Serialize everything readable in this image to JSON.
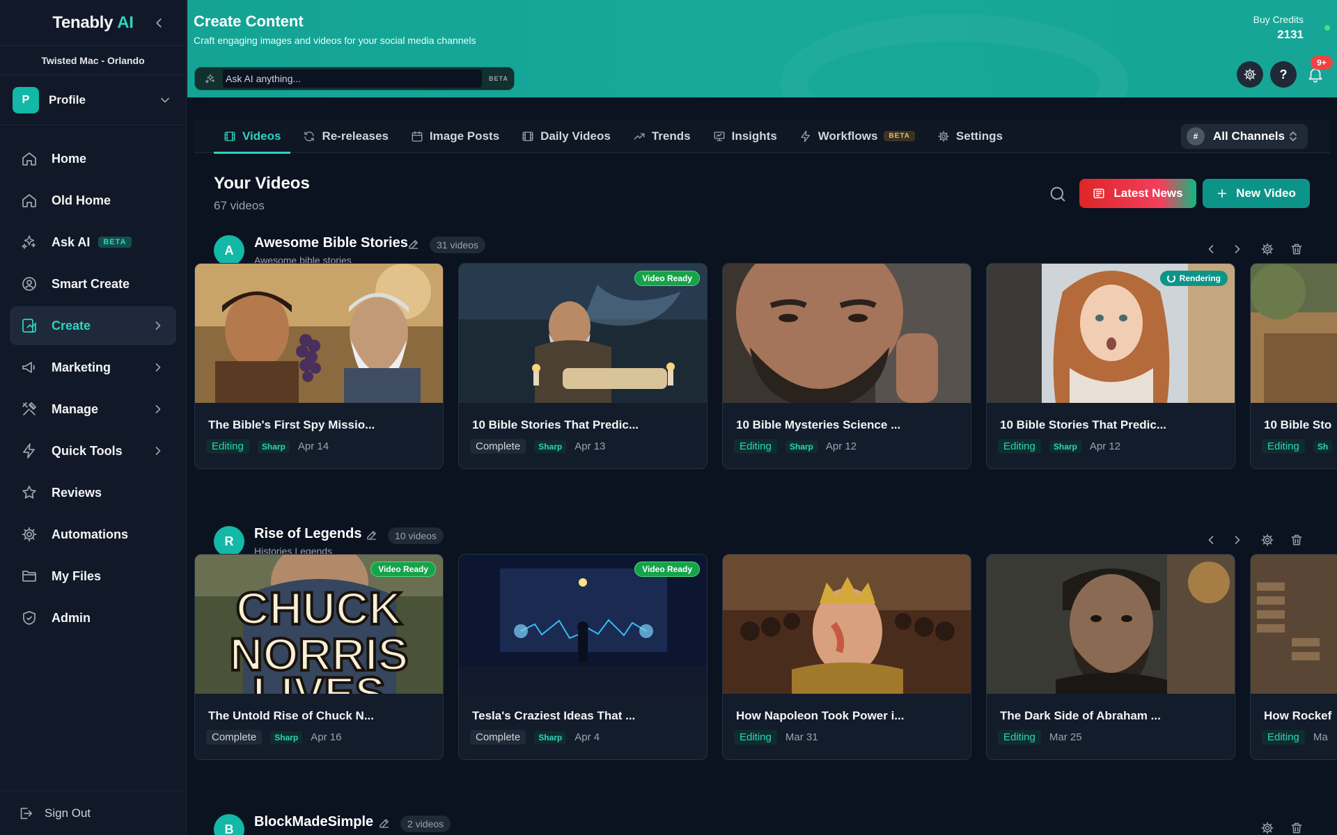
{
  "app": {
    "logo_main": "Tenably",
    "logo_accent": "AI",
    "org": "Twisted Mac - Orlando"
  },
  "profile": {
    "initial": "P",
    "label": "Profile"
  },
  "sidebar": {
    "items": [
      {
        "label": "Home",
        "icon": "home-icon"
      },
      {
        "label": "Old Home",
        "icon": "home-icon"
      },
      {
        "label": "Ask AI",
        "icon": "sparkle-icon",
        "badge": "BETA"
      },
      {
        "label": "Smart Create",
        "icon": "user-circle-icon"
      },
      {
        "label": "Create",
        "icon": "create-icon",
        "active": true
      },
      {
        "label": "Marketing",
        "icon": "megaphone-icon"
      },
      {
        "label": "Manage",
        "icon": "tools-icon"
      },
      {
        "label": "Quick Tools",
        "icon": "bolt-icon"
      },
      {
        "label": "Reviews",
        "icon": "star-icon"
      },
      {
        "label": "Automations",
        "icon": "gear-icon"
      },
      {
        "label": "My Files",
        "icon": "folder-icon"
      },
      {
        "label": "Admin",
        "icon": "shield-icon"
      }
    ],
    "sign_out": "Sign Out"
  },
  "header": {
    "title": "Create Content",
    "subtitle": "Craft engaging images and videos for your social media channels",
    "ask_placeholder": "Ask AI anything...",
    "ask_badge": "BETA",
    "credits_label": "Buy Credits",
    "credits_value": "2131",
    "help_glyph": "?",
    "notif_count": "9+"
  },
  "tabs": [
    {
      "label": "Videos",
      "icon": "film-icon",
      "active": true
    },
    {
      "label": "Re-releases",
      "icon": "refresh-icon"
    },
    {
      "label": "Image Posts",
      "icon": "calendar-icon"
    },
    {
      "label": "Daily Videos",
      "icon": "film-icon"
    },
    {
      "label": "Trends",
      "icon": "trend-icon"
    },
    {
      "label": "Insights",
      "icon": "presentation-icon"
    },
    {
      "label": "Workflows",
      "icon": "bolt-icon",
      "badge": "BETA"
    },
    {
      "label": "Settings",
      "icon": "gear-icon"
    }
  ],
  "channel_select": {
    "hash": "#",
    "label": "All Channels"
  },
  "content": {
    "title": "Your Videos",
    "count": "67 videos",
    "latest_news": "Latest News",
    "new_video": "New Video"
  },
  "sections": [
    {
      "initial": "A",
      "title": "Awesome Bible Stories",
      "subtitle": "Awesome bible stories",
      "count": "31 videos",
      "cards": [
        {
          "title": "The Bible's First Spy Missio...",
          "status": "Editing",
          "quality": "Sharp",
          "date": "Apr 14",
          "badge": ""
        },
        {
          "title": "10 Bible Stories That Predic...",
          "status": "Complete",
          "quality": "Sharp",
          "date": "Apr 13",
          "badge": "Video Ready"
        },
        {
          "title": "10 Bible Mysteries Science ...",
          "status": "Editing",
          "quality": "Sharp",
          "date": "Apr 12",
          "badge": ""
        },
        {
          "title": "10 Bible Stories That Predic...",
          "status": "Editing",
          "quality": "Sharp",
          "date": "Apr 12",
          "badge": "Rendering"
        },
        {
          "title": "10 Bible Sto",
          "status": "Editing",
          "quality": "Sh",
          "date": "",
          "badge": ""
        }
      ]
    },
    {
      "initial": "R",
      "title": "Rise of Legends",
      "subtitle": "Histories Legends",
      "count": "10 videos",
      "cards": [
        {
          "title": "The Untold Rise of Chuck N...",
          "status": "Complete",
          "quality": "Sharp",
          "date": "Apr 16",
          "badge": "Video Ready",
          "thumb_text_1": "CHUCK",
          "thumb_text_2": "NORRIS",
          "thumb_text_3": "LIVES"
        },
        {
          "title": "Tesla's Craziest Ideas That ...",
          "status": "Complete",
          "quality": "Sharp",
          "date": "Apr 4",
          "badge": "Video Ready"
        },
        {
          "title": "How Napoleon Took Power i...",
          "status": "Editing",
          "quality": "",
          "date": "Mar 31",
          "badge": ""
        },
        {
          "title": "The Dark Side of Abraham ...",
          "status": "Editing",
          "quality": "",
          "date": "Mar 25",
          "badge": ""
        },
        {
          "title": "How Rockef",
          "status": "Editing",
          "quality": "",
          "date": "Ma",
          "badge": ""
        }
      ]
    },
    {
      "initial": "B",
      "title": "BlockMadeSimple",
      "subtitle": "",
      "count": "2 videos",
      "cards": []
    }
  ],
  "colors": {
    "accent": "#2dd4bf",
    "header_bg": "#16a596",
    "sidebar_bg": "#111827",
    "page_bg": "#0b1220",
    "danger": "#ef4444",
    "ready": "#16a34a"
  }
}
